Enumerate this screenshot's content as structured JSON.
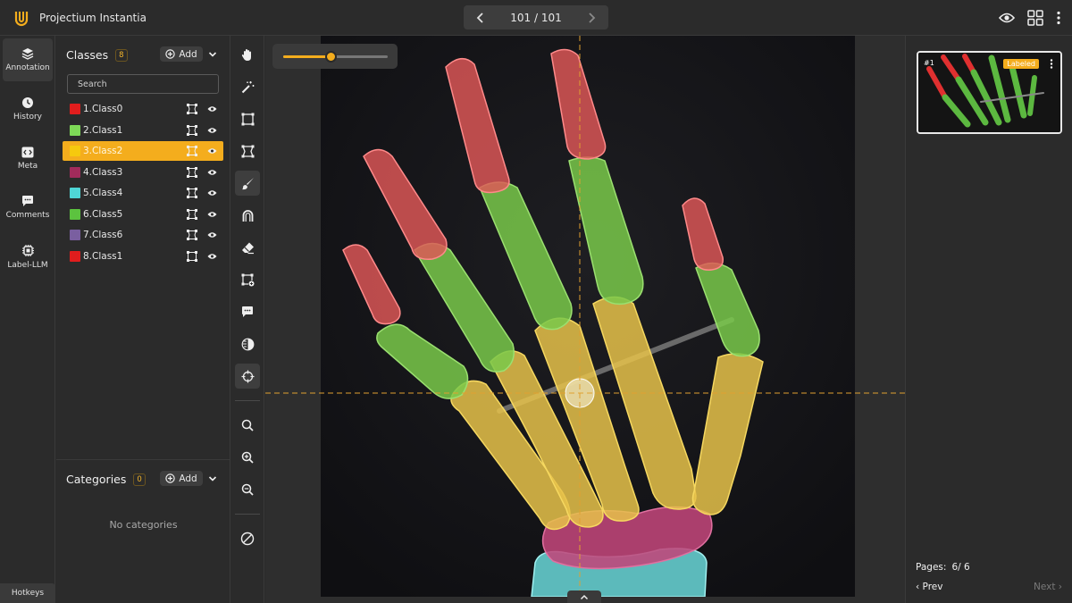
{
  "app": {
    "title": "Projectium Instantia",
    "brand_color": "#f4ad1d"
  },
  "pager": {
    "count": "101 / 101",
    "prev_icon": "chevron-left-icon",
    "next_icon": "chevron-right-icon"
  },
  "top_icons": [
    "eye-icon",
    "grid-icon",
    "more-vertical-icon"
  ],
  "nav": {
    "items": [
      {
        "label": "Annotation",
        "icon": "layers-icon",
        "active": true
      },
      {
        "label": "History",
        "icon": "clock-icon",
        "active": false
      },
      {
        "label": "Meta",
        "icon": "code-icon",
        "active": false
      },
      {
        "label": "Comments",
        "icon": "comment-icon",
        "active": false
      },
      {
        "label": "Label-LLM",
        "icon": "chip-icon",
        "active": false
      }
    ],
    "hotkeys": "Hotkeys"
  },
  "classes": {
    "title": "Classes",
    "count": "8",
    "add_label": "Add",
    "search_placeholder": "Search",
    "items": [
      {
        "label": "1.Class0",
        "color": "#e11d1d",
        "shape": "polygon-icon"
      },
      {
        "label": "2.Class1",
        "color": "#7ed957",
        "shape": "polygon-icon"
      },
      {
        "label": "3.Class2",
        "color": "#f6c90e",
        "shape": "polygon-icon",
        "selected": true
      },
      {
        "label": "4.Class3",
        "color": "#a12b5b",
        "shape": "polygon-icon"
      },
      {
        "label": "5.Class4",
        "color": "#4fd6d6",
        "shape": "polygon-icon"
      },
      {
        "label": "6.Class5",
        "color": "#5cc33f",
        "shape": "polygon-icon"
      },
      {
        "label": "7.Class6",
        "color": "#7a5fa0",
        "shape": "polygon-icon"
      },
      {
        "label": "8.Class1",
        "color": "#e11d1d",
        "shape": "bbox-icon"
      }
    ]
  },
  "categories": {
    "title": "Categories",
    "count": "0",
    "add_label": "Add",
    "empty_text": "No categories"
  },
  "tools": [
    "hand-icon",
    "magic-wand-icon",
    "rectangle-icon",
    "polygon-icon",
    "brush-icon",
    "magnet-icon",
    "eraser-icon",
    "keypoint-icon",
    "comment-icon",
    "contrast-icon",
    "crosshair-icon",
    "search-icon",
    "zoom-in-icon",
    "zoom-out-icon",
    "no-entry-icon"
  ],
  "brush_size": 0.45,
  "thumbnail": {
    "number": "#1",
    "status": "Labeled"
  },
  "pagination": {
    "pages_label": "Pages:",
    "pages_value": "6/ 6",
    "prev_label": "Prev",
    "next_label": "Next"
  }
}
